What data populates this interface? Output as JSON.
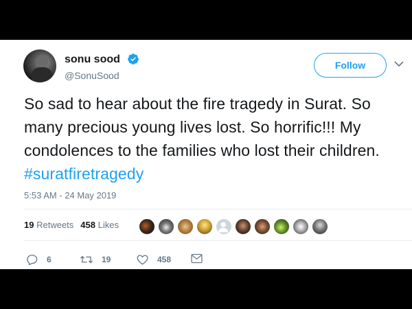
{
  "user": {
    "name": "sonu sood",
    "handle": "@SonuSood"
  },
  "follow_label": "Follow",
  "tweet": {
    "text_main": "So sad to hear about the fire tragedy in Surat. So many precious young lives lost. So horrific!!! My condolences to the families who lost their children.",
    "hashtag": "#suratfiretragedy",
    "timestamp": "5:53 AM - 24 May 2019"
  },
  "stats": {
    "retweets_count": "19",
    "retweets_label": "Retweets",
    "likes_count": "458",
    "likes_label": "Likes"
  },
  "actions": {
    "reply_count": "6",
    "retweet_count": "19",
    "like_count": "458"
  },
  "colors": {
    "accent": "#1da1f2",
    "text": "#14171a",
    "muted": "#657786"
  },
  "icons": [
    "verified-badge-icon",
    "chevron-down-icon",
    "reply-icon",
    "retweet-icon",
    "heart-icon",
    "envelope-icon"
  ]
}
